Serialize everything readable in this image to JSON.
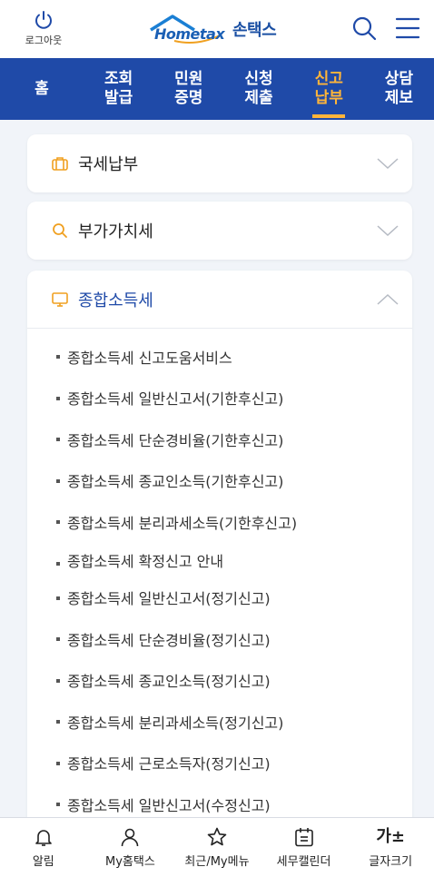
{
  "header": {
    "logout_label": "로그아웃",
    "logo_brand": "Hometax",
    "logo_suffix": "손택스",
    "brand_color": "#1f4aa8",
    "accent_color": "#ffb53a"
  },
  "nav": {
    "items": [
      {
        "label": "홈",
        "active": false
      },
      {
        "label": "조회\n발급",
        "active": false
      },
      {
        "label": "민원\n증명",
        "active": false
      },
      {
        "label": "신청\n제출",
        "active": false
      },
      {
        "label": "신고\n납부",
        "active": true
      },
      {
        "label": "상담\n제보",
        "active": false
      }
    ]
  },
  "sections": [
    {
      "title": "국세납부",
      "icon": "briefcase-icon",
      "expanded": false
    },
    {
      "title": "부가가치세",
      "icon": "search-icon",
      "expanded": false
    },
    {
      "title": "종합소득세",
      "icon": "monitor-icon",
      "expanded": true
    }
  ],
  "income_tax_items": [
    "종합소득세 신고도움서비스",
    "종합소득세 일반신고서(기한후신고)",
    "종합소득세 단순경비율(기한후신고)",
    "종합소득세 종교인소득(기한후신고)",
    "종합소득세 분리과세소득(기한후신고)",
    "종합소득세 확정신고 안내",
    "종합소득세 일반신고서(정기신고)",
    "종합소득세 단순경비율(정기신고)",
    "종합소득세 종교인소득(정기신고)",
    "종합소득세 분리과세소득(정기신고)",
    "종합소득세 근로소득자(정기신고)",
    "종합소득세 일반신고서(수정신고)"
  ],
  "bottombar": {
    "items": [
      {
        "label": "알림",
        "icon": "bell-icon"
      },
      {
        "label": "My홈택스",
        "icon": "person-icon"
      },
      {
        "label": "최근/My메뉴",
        "icon": "star-icon"
      },
      {
        "label": "세무캘린더",
        "icon": "calendar-icon"
      },
      {
        "label": "글자크기",
        "icon": "font-size-icon",
        "glyph": "가±"
      }
    ]
  }
}
